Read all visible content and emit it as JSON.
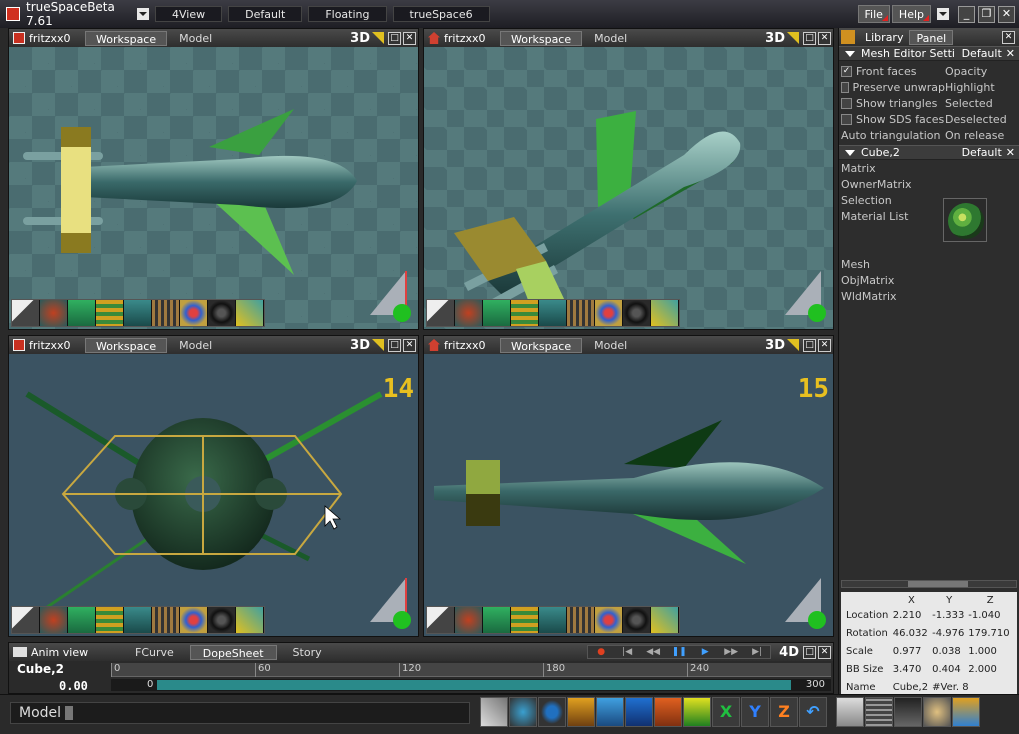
{
  "app": {
    "title": "trueSpaceBeta 7.61",
    "layouts": [
      "4View",
      "Default",
      "Floating",
      "trueSpace6"
    ],
    "menu": {
      "file": "File",
      "help": "Help"
    },
    "window_controls": {
      "minimize": "_",
      "restore": "❐",
      "close": "✕"
    }
  },
  "viewports": [
    {
      "name": "fritzxx0",
      "tabs": [
        "Workspace",
        "Model"
      ],
      "active_tab": "Workspace",
      "mode": "3D",
      "frame": ""
    },
    {
      "name": "fritzxx0",
      "tabs": [
        "Workspace",
        "Model"
      ],
      "active_tab": "Workspace",
      "mode": "3D",
      "frame": ""
    },
    {
      "name": "fritzxx0",
      "tabs": [
        "Workspace",
        "Model"
      ],
      "active_tab": "Workspace",
      "mode": "3D",
      "frame": "14"
    },
    {
      "name": "fritzxx0",
      "tabs": [
        "Workspace",
        "Model"
      ],
      "active_tab": "Workspace",
      "mode": "3D",
      "frame": "15"
    }
  ],
  "viewport_toolbar_icons": [
    "arrow-select-icon",
    "paint-icon",
    "cube-icon",
    "layers-icon",
    "camera-icon",
    "rake-icon",
    "palette-icon",
    "tire-icon",
    "wand-icon"
  ],
  "sidebar": {
    "tabs": [
      "Library",
      "Panel"
    ],
    "active_tab": "Panel",
    "mesh_editor": {
      "title": "Mesh Editor Setti",
      "preset": "Default",
      "options_left": [
        {
          "label": "Front faces",
          "checked": true
        },
        {
          "label": "Preserve unwrap",
          "checked": false
        },
        {
          "label": "Show triangles",
          "checked": false
        },
        {
          "label": "Show SDS faces",
          "checked": false
        },
        {
          "label": "Auto triangulation",
          "checked": null
        }
      ],
      "options_right": [
        "Opacity",
        "Highlight",
        "Selected",
        "Deselected",
        "On release"
      ]
    },
    "object_panel": {
      "title": "Cube,2",
      "preset": "Default",
      "props": [
        "Matrix",
        "OwnerMatrix",
        "Selection",
        "Material List",
        "",
        "",
        "Mesh",
        "ObjMatrix",
        "WldMatrix"
      ]
    },
    "coords": {
      "headers": [
        "X",
        "Y",
        "Z"
      ],
      "rows": [
        {
          "label": "Location",
          "x": "2.210",
          "y": "-1.333",
          "z": "-1.040"
        },
        {
          "label": "Rotation",
          "x": "46.032",
          "y": "-4.976",
          "z": "179.710"
        },
        {
          "label": "Scale",
          "x": "0.977",
          "y": "0.038",
          "z": "1.000"
        },
        {
          "label": "BB Size",
          "x": "3.470",
          "y": "0.404",
          "z": "2.000"
        }
      ],
      "name_label": "Name",
      "name_value": "Cube,2",
      "vert_label": "#Ver. 8"
    }
  },
  "anim": {
    "title": "Anim view",
    "tabs": [
      "FCurve",
      "DopeSheet",
      "Story"
    ],
    "active_tab": "DopeSheet",
    "mode": "4D",
    "object": "Cube,2",
    "time": "0.00",
    "ruler_ticks": [
      "0",
      "60",
      "120",
      "180",
      "240"
    ],
    "track_start": "0",
    "track_end": "300"
  },
  "status": {
    "text": "Model"
  },
  "bottom_toolbar_icons": [
    "move-icon",
    "rotate-icon",
    "scale-icon",
    "object-icon",
    "plane-icon",
    "box-icon",
    "home-icon",
    "axis-icon",
    "x-axis-icon",
    "y-axis-icon",
    "z-axis-icon",
    "undo-icon",
    "save-icon",
    "grid-icon",
    "render-icon",
    "people-icon",
    "paint-bucket-icon"
  ],
  "bottom_toolbar_glyphs": {
    "x": "X",
    "y": "Y",
    "z": "Z"
  },
  "colors": {
    "accent": "#e0c020",
    "viewport_bg": "#3b5362",
    "frame_number": "#e8c020",
    "track_fill": "#2a8a8a"
  }
}
